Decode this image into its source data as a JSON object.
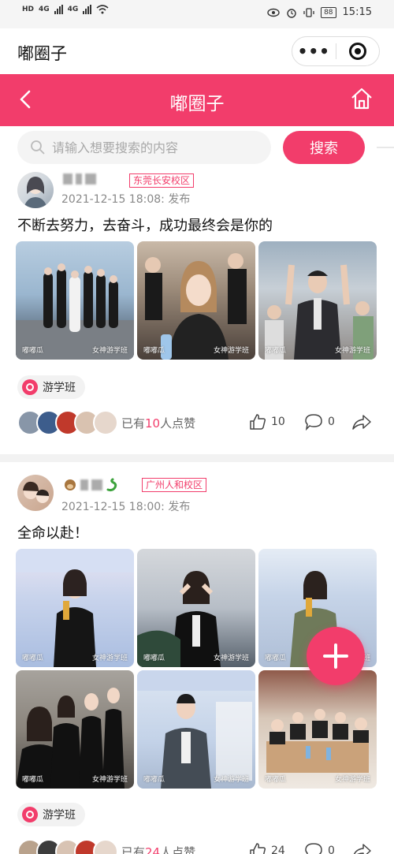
{
  "status_bar": {
    "left_labels": [
      "HD",
      "4G",
      "HD",
      "4G"
    ],
    "battery": "88",
    "time": "15:15"
  },
  "miniprogram": {
    "title": "嘟圈子",
    "more_icon": "ellipsis-icon",
    "close_icon": "target-icon"
  },
  "header": {
    "title": "嘟圈子",
    "back_icon": "chevron-left-icon",
    "home_icon": "home-icon"
  },
  "search": {
    "placeholder": "请输入想要搜索的内容",
    "button": "搜索"
  },
  "posts": [
    {
      "campus": "东莞长安校区",
      "time": "2021-12-15 18:08: 发布",
      "text": "不断去努力，去奋斗，成功最终会是你的",
      "photo_watermark": "嘟嘟瓜",
      "photo_caption": "女神游学班",
      "tag": "游学班",
      "liked_prefix": "已有",
      "liked_count": "10",
      "liked_suffix": "人点赞",
      "likes": "10",
      "comments": "0"
    },
    {
      "campus": "广州人和校区",
      "time": "2021-12-15 18:00: 发布",
      "text": "全命以赴！",
      "photo_watermark": "嘟嘟瓜",
      "photo_caption": "女神游学班",
      "tag": "游学班",
      "liked_prefix": "已有",
      "liked_count": "24",
      "liked_suffix": "人点赞",
      "likes": "24",
      "comments": "0"
    }
  ],
  "fab": {
    "icon": "plus-icon"
  },
  "colors": {
    "accent": "#f23d6b",
    "muted": "#888888"
  }
}
